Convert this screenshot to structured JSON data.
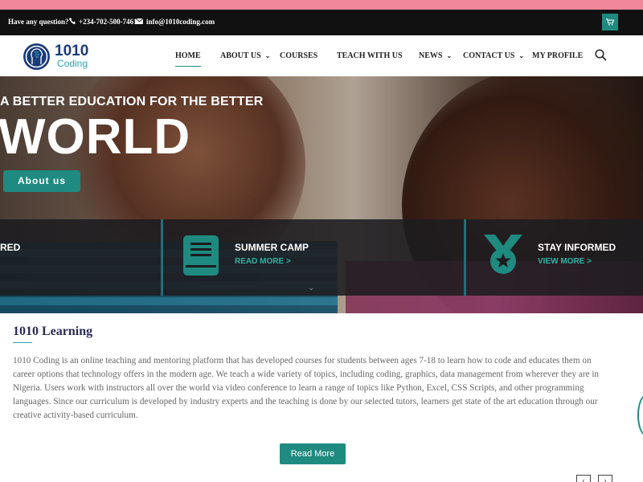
{
  "colors": {
    "accent": "#1f8a80",
    "topbar": "#111111",
    "pinkStrip": "#f0879a",
    "link": "#2fb3a6"
  },
  "topbar": {
    "question": "Have any question?",
    "phone": "+234-702-500-7461",
    "email": "info@1010coding.com",
    "icons": {
      "phone": "phone-icon",
      "email": "envelope-icon",
      "cart": "cart-icon"
    }
  },
  "logo": {
    "brand": "1010",
    "sub": "Coding"
  },
  "nav": {
    "home": "HOME",
    "about": "ABOUT US",
    "courses": "COURSES",
    "teach": "TEACH WITH US",
    "news": "NEWS",
    "contact": "CONTACT US",
    "profile": "MY PROFILE"
  },
  "hero": {
    "tagline": "A BETTER EDUCATION FOR THE BETTER",
    "title": "WORLD",
    "button": "About us"
  },
  "features": {
    "left_partial": "RED",
    "camp_title": "SUMMER CAMP",
    "camp_link": "READ MORE >",
    "inform_title": "STAY INFORMED",
    "inform_link": "VIEW MORE >"
  },
  "content": {
    "title": "1010 Learning",
    "paragraph": "1010 Coding is an online teaching and mentoring platform that has developed courses for students between ages 7-18 to learn how to code and educates them on career options that technology offers in the modern age. We teach a wide variety of topics, including coding, graphics, data management from wherever they are in Nigeria. Users work with instructors all over the world via video conference to learn a range of topics like Python, Excel, CSS Scripts, and other programming languages. Since our curriculum is developed by industry experts and the teaching is done by our selected tutors, learners get state of the art education through our creative activity-based curriculum.",
    "button": "Read More",
    "prev": "‹",
    "next": "›"
  }
}
